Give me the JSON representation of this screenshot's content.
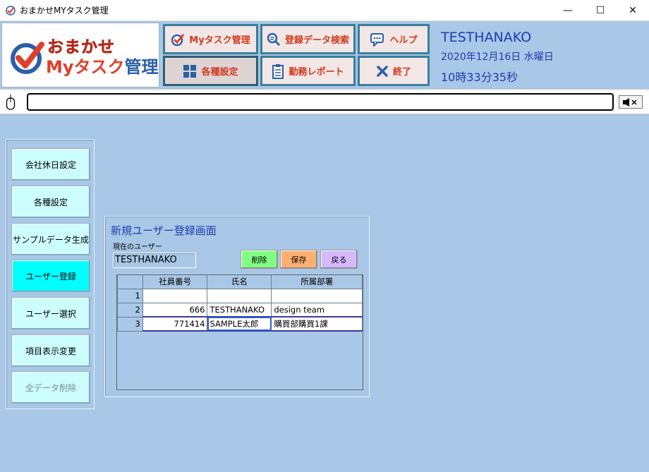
{
  "window": {
    "title": "おまかせMYタスク管理",
    "controls": [
      "—",
      "☐",
      "✕"
    ]
  },
  "logo": {
    "top": "おまかせ",
    "bottom_red": "Myタスク",
    "bottom_blue": "管理"
  },
  "header_buttons": {
    "mytask": "Myタスク管理",
    "search": "登録データ検索",
    "help": "ヘルプ",
    "settings": "各種設定",
    "report": "勤務レポート",
    "exit": "終了"
  },
  "user_info": {
    "name": "TESTHANAKO",
    "date": "2020年12月16日  水曜日",
    "time": "10時33分35秒"
  },
  "message": "",
  "sidebar": {
    "items": [
      {
        "label": "会社休日設定",
        "state": "normal"
      },
      {
        "label": "各種設定",
        "state": "normal"
      },
      {
        "label": "サンプルデータ生成",
        "state": "normal"
      },
      {
        "label": "ユーザー登録",
        "state": "active"
      },
      {
        "label": "ユーザー選択",
        "state": "normal"
      },
      {
        "label": "項目表示変更",
        "state": "normal"
      },
      {
        "label": "全データ削除",
        "state": "disabled"
      }
    ]
  },
  "panel": {
    "title": "新規ユーザー登録画面",
    "current_user_label": "現在のユーザー",
    "current_user_value": "TESTHANAKO",
    "buttons": {
      "delete": "削除",
      "save": "保存",
      "back": "戻る"
    },
    "colors": {
      "delete": "#80ff80",
      "save": "#ffb070",
      "back": "#d6b8ff"
    },
    "grid": {
      "columns": [
        "社員番号",
        "氏名",
        "所属部署"
      ],
      "rows": [
        {
          "rn": "1",
          "id": "",
          "name": "",
          "dept": ""
        },
        {
          "rn": "2",
          "id": "666",
          "name": "TESTHANAKO",
          "dept": "design team"
        },
        {
          "rn": "3",
          "id": "771414",
          "name": "SAMPLE太郎",
          "dept": "購買部購買1課"
        }
      ]
    }
  }
}
